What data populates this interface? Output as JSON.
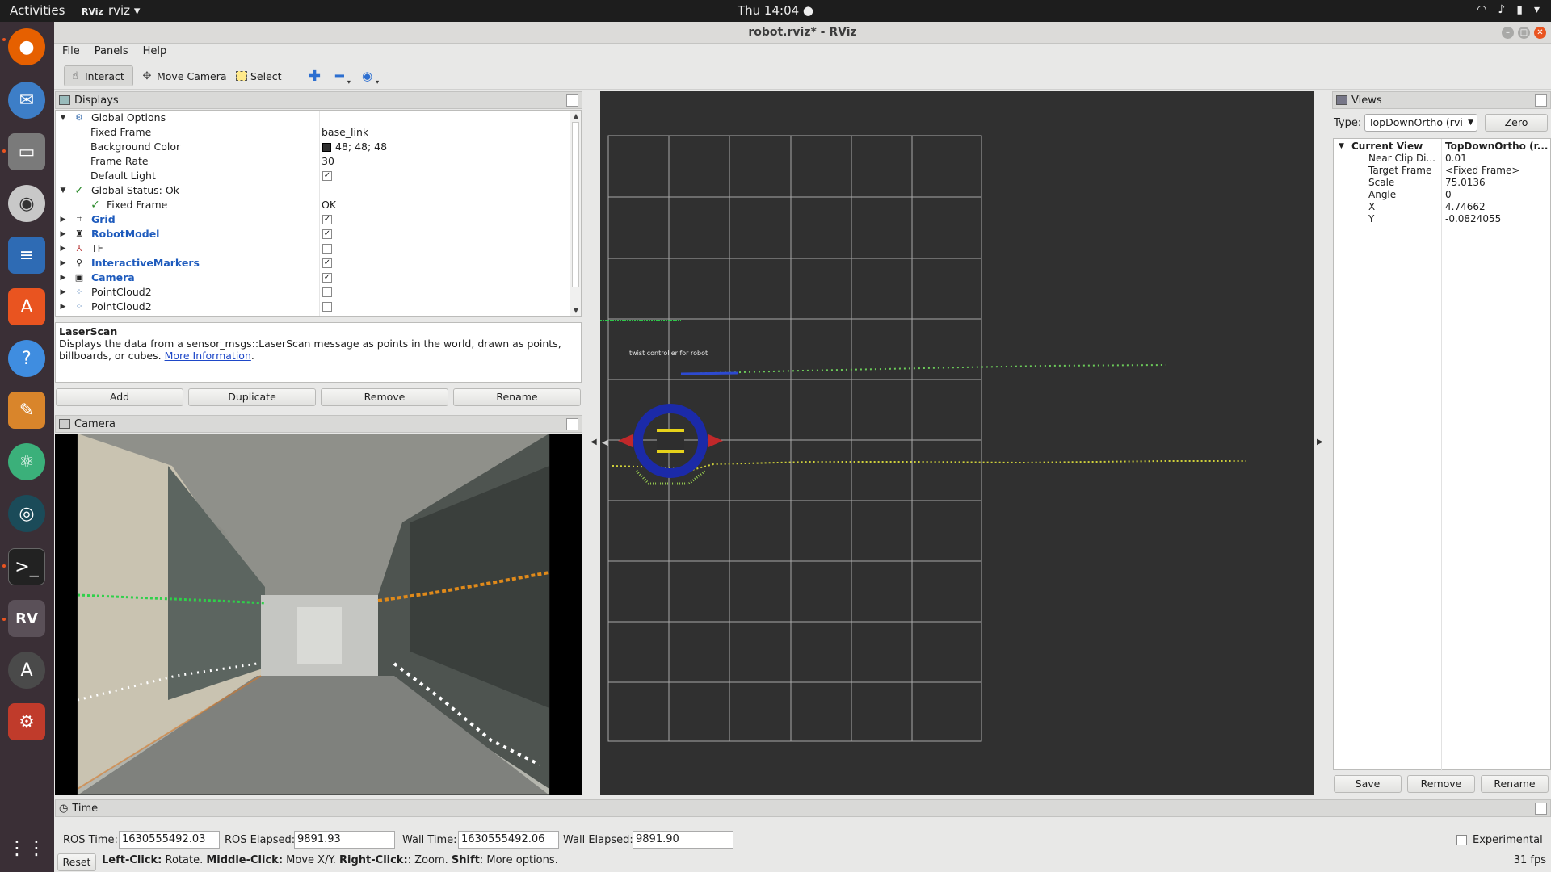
{
  "topbar": {
    "activities": "Activities",
    "app_name": "rviz",
    "app_badge": "RViz",
    "clock": "Thu 14:04 ●"
  },
  "window": {
    "title": "robot.rviz* - RViz"
  },
  "menu": {
    "file": "File",
    "panels": "Panels",
    "help": "Help"
  },
  "toolbar": {
    "interact": "Interact",
    "move_camera": "Move Camera",
    "select": "Select"
  },
  "displays": {
    "title": "Displays",
    "rows": [
      {
        "label": "Global Options",
        "value": ""
      },
      {
        "label": "Fixed Frame",
        "value": "base_link"
      },
      {
        "label": "Background Color",
        "value": "48; 48; 48"
      },
      {
        "label": "Frame Rate",
        "value": "30"
      },
      {
        "label": "Default Light",
        "value": ""
      },
      {
        "label": "Global Status: Ok",
        "value": ""
      },
      {
        "label": "Fixed Frame",
        "value": "OK"
      },
      {
        "label": "Grid",
        "value": ""
      },
      {
        "label": "RobotModel",
        "value": ""
      },
      {
        "label": "TF",
        "value": ""
      },
      {
        "label": "InteractiveMarkers",
        "value": ""
      },
      {
        "label": "Camera",
        "value": ""
      },
      {
        "label": "PointCloud2",
        "value": ""
      },
      {
        "label": "PointCloud2",
        "value": ""
      }
    ],
    "checkbox_states": {
      "default_light": true,
      "grid": true,
      "robotmodel": true,
      "tf": false,
      "interactive_markers": true,
      "camera": true,
      "pointcloud2_a": false,
      "pointcloud2_b": false
    },
    "desc_title": "LaserScan",
    "desc_text": "Displays the data from a sensor_msgs::LaserScan message as points in the world, drawn as points, billboards, or cubes.",
    "desc_link": "More Information",
    "btn_add": "Add",
    "btn_duplicate": "Duplicate",
    "btn_remove": "Remove",
    "btn_rename": "Rename"
  },
  "camera": {
    "title": "Camera"
  },
  "view3d": {
    "marker_text": "twist controller for robot"
  },
  "views": {
    "title": "Views",
    "type_label": "Type:",
    "type_value": "TopDownOrtho (rvi",
    "zero": "Zero",
    "current_view": "Current View",
    "current_view_value": "TopDownOrtho (r...",
    "props": [
      {
        "k": "Near Clip Di...",
        "v": "0.01"
      },
      {
        "k": "Target Frame",
        "v": "<Fixed Frame>"
      },
      {
        "k": "Scale",
        "v": "75.0136"
      },
      {
        "k": "Angle",
        "v": "0"
      },
      {
        "k": "X",
        "v": "4.74662"
      },
      {
        "k": "Y",
        "v": "-0.0824055"
      }
    ],
    "save": "Save",
    "remove": "Remove",
    "rename": "Rename"
  },
  "time": {
    "title": "Time",
    "ros_time_label": "ROS Time:",
    "ros_time": "1630555492.03",
    "ros_elapsed_label": "ROS Elapsed:",
    "ros_elapsed": "9891.93",
    "wall_time_label": "Wall Time:",
    "wall_time": "1630555492.06",
    "wall_elapsed_label": "Wall Elapsed:",
    "wall_elapsed": "9891.90",
    "experimental": "Experimental",
    "reset": "Reset",
    "hint_left": "Left-Click:",
    "hint_left_t": " Rotate. ",
    "hint_mid": "Middle-Click:",
    "hint_mid_t": " Move X/Y. ",
    "hint_right": "Right-Click:",
    "hint_right_t": ": Zoom. ",
    "hint_shift": "Shift",
    "hint_shift_t": ": More options.",
    "fps": "31 fps"
  }
}
